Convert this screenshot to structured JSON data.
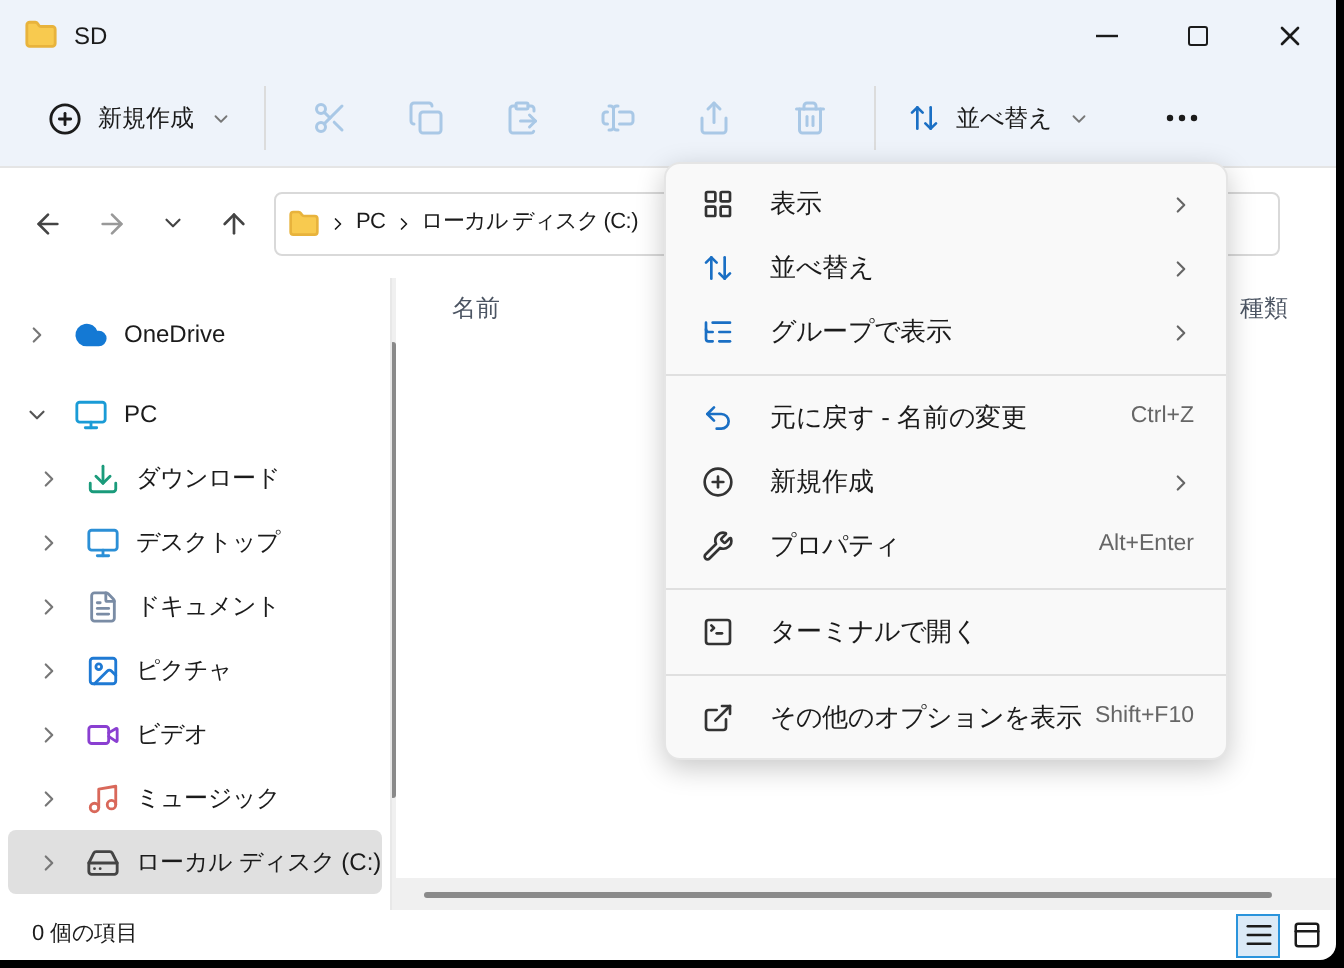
{
  "window": {
    "title": "SD"
  },
  "toolbar": {
    "new_button": {
      "label": "新規作成"
    },
    "actions": [
      {
        "disabled": true
      },
      {
        "disabled": true
      },
      {
        "disabled": true
      },
      {
        "disabled": true
      },
      {
        "disabled": true
      },
      {
        "disabled": true
      }
    ],
    "sort_button": {
      "label": "並べ替え"
    }
  },
  "address_bar": {
    "breadcrumbs": [
      "PC",
      "ローカル ディスク (C:)"
    ]
  },
  "sidebar": {
    "items": [
      {
        "label": "OneDrive",
        "expanded": false,
        "selected": false
      },
      {
        "label": "PC",
        "expanded": true,
        "selected": false,
        "children": [
          {
            "label": "ダウンロード",
            "expanded": false,
            "selected": false
          },
          {
            "label": "デスクトップ",
            "expanded": false,
            "selected": false
          },
          {
            "label": "ドキュメント",
            "expanded": false,
            "selected": false
          },
          {
            "label": "ピクチャ",
            "expanded": false,
            "selected": false
          },
          {
            "label": "ビデオ",
            "expanded": false,
            "selected": false
          },
          {
            "label": "ミュージック",
            "expanded": false,
            "selected": false
          },
          {
            "label": "ローカル ディスク (C:)",
            "expanded": false,
            "selected": true
          }
        ]
      }
    ]
  },
  "file_list": {
    "columns": [
      "名前",
      "種類"
    ]
  },
  "context_menu": {
    "groups": [
      [
        {
          "label": "表示",
          "submenu": true
        },
        {
          "label": "並べ替え",
          "submenu": true
        },
        {
          "label": "グループで表示",
          "submenu": true
        }
      ],
      [
        {
          "label": "元に戻す - 名前の変更",
          "shortcut": "Ctrl+Z",
          "submenu": false
        },
        {
          "label": "新規作成",
          "submenu": true
        },
        {
          "label": "プロパティ",
          "shortcut": "Alt+Enter",
          "submenu": false
        }
      ],
      [
        {
          "label": "ターミナルで開く",
          "submenu": false
        }
      ],
      [
        {
          "label": "その他のオプションを表示",
          "shortcut": "Shift+F10",
          "submenu": false
        }
      ]
    ]
  },
  "status_bar": {
    "item_count": "0 個の項目",
    "views": [
      {
        "selected": true
      },
      {
        "selected": false
      }
    ]
  }
}
